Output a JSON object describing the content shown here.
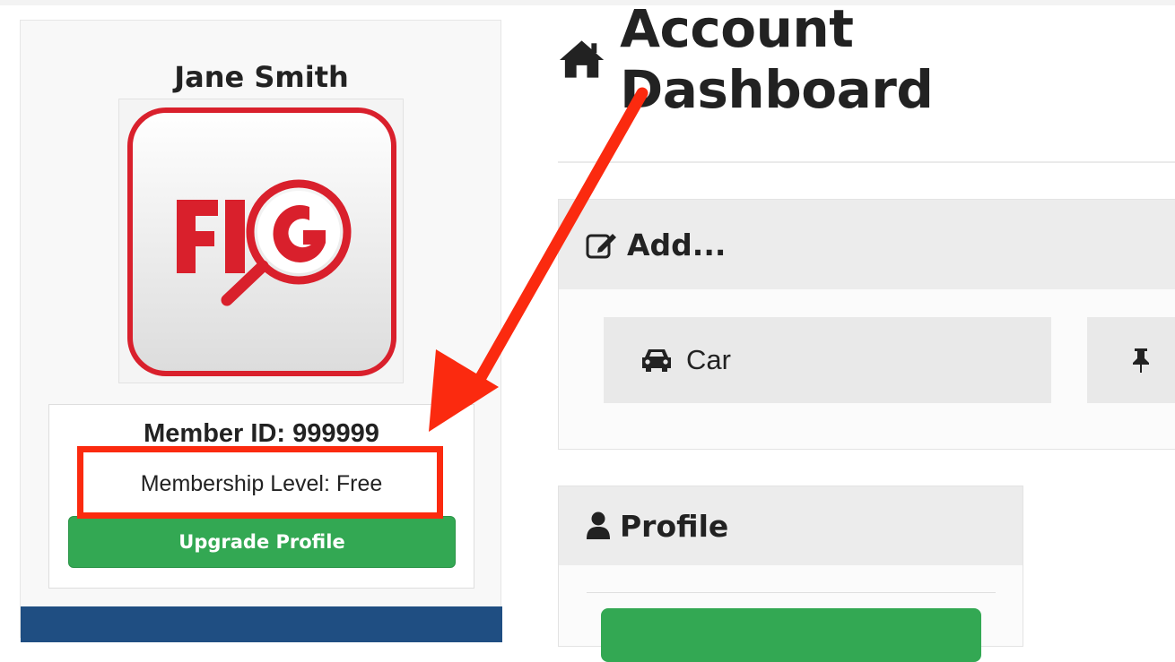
{
  "sidebar": {
    "user_name": "Jane Smith",
    "logo_text": "FIG",
    "member_id": "Member ID: 999999",
    "membership_level": "Membership Level: Free",
    "upgrade_label": "Upgrade Profile"
  },
  "main": {
    "title": "Account Dashboard",
    "title_icon": "home-icon",
    "add_panel": {
      "heading": "Add...",
      "heading_icon": "edit-icon",
      "items": [
        {
          "label": "Car",
          "icon": "car-icon"
        },
        {
          "label": "",
          "icon": "pin-icon"
        }
      ]
    },
    "profile_panel": {
      "heading": "Profile",
      "heading_icon": "user-icon"
    }
  },
  "colors": {
    "accent_green": "#33a853",
    "brand_red": "#d9202c",
    "annotation_red": "#fb2a0f",
    "nav_blue": "#1f4e82"
  }
}
